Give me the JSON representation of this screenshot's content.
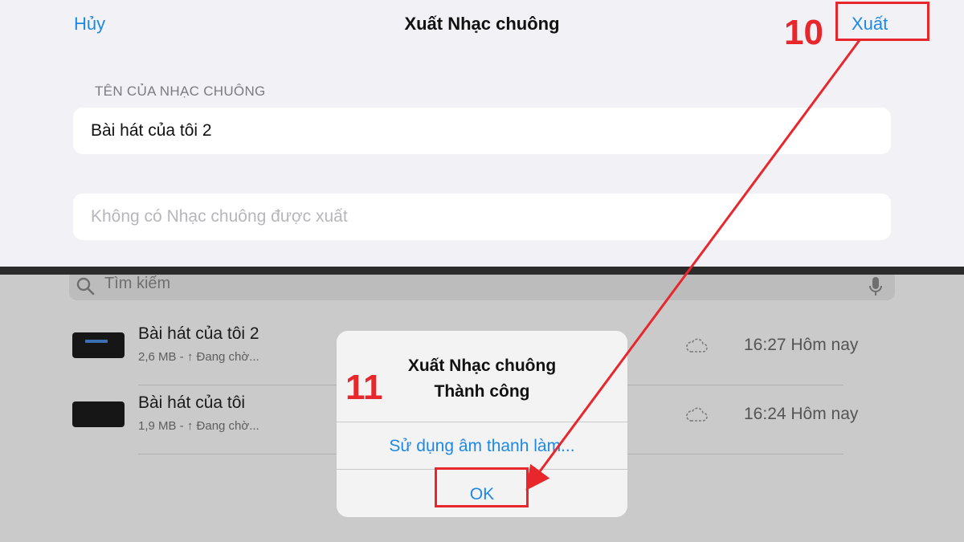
{
  "nav": {
    "cancel_label": "Hủy",
    "title": "Xuất Nhạc chuông",
    "export_label": "Xuất"
  },
  "form": {
    "section_label": "TÊN CỦA NHẠC CHUÔNG",
    "name_value": "Bài hát của tôi 2",
    "ringtone_status": "Không có Nhạc chuông được xuất"
  },
  "search": {
    "placeholder": "Tìm kiếm"
  },
  "files": [
    {
      "name": "Bài hát của tôi 2",
      "meta": "2,6 MB - ↑ Đang chờ...",
      "time": "16:27 Hôm nay"
    },
    {
      "name": "Bài hát của tôi",
      "meta": "1,9 MB - ↑ Đang chờ...",
      "time": "16:24 Hôm nay"
    }
  ],
  "alert": {
    "title_line1": "Xuất Nhạc chuông",
    "title_line2": "Thành công",
    "action_label": "Sử dụng âm thanh làm...",
    "ok_label": "OK"
  },
  "annotations": {
    "step_export": "10",
    "step_ok": "11",
    "highlight_color": "#e8272c"
  },
  "colors": {
    "accent": "#1e88e5",
    "panel_bg": "#f2f2f6",
    "dimmed_bg": "#cacaca"
  },
  "icons": {
    "search": "search-icon",
    "mic": "mic-icon",
    "cloud": "cloud-icon"
  }
}
